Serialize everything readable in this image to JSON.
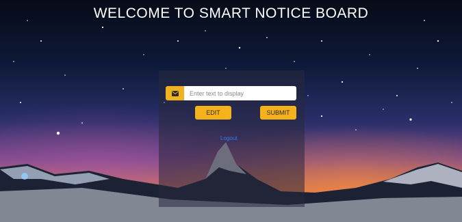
{
  "header": {
    "title": "WELCOME TO SMART NOTICE BOARD"
  },
  "form": {
    "input_placeholder": "Enter text to display",
    "input_icon": "envelope-icon",
    "edit_label": "EDIT",
    "submit_label": "SUBMIT",
    "logout_label": "Logout"
  },
  "colors": {
    "accent": "#f6b21a",
    "link": "#2f7ee6",
    "title_text": "#ffffff"
  }
}
